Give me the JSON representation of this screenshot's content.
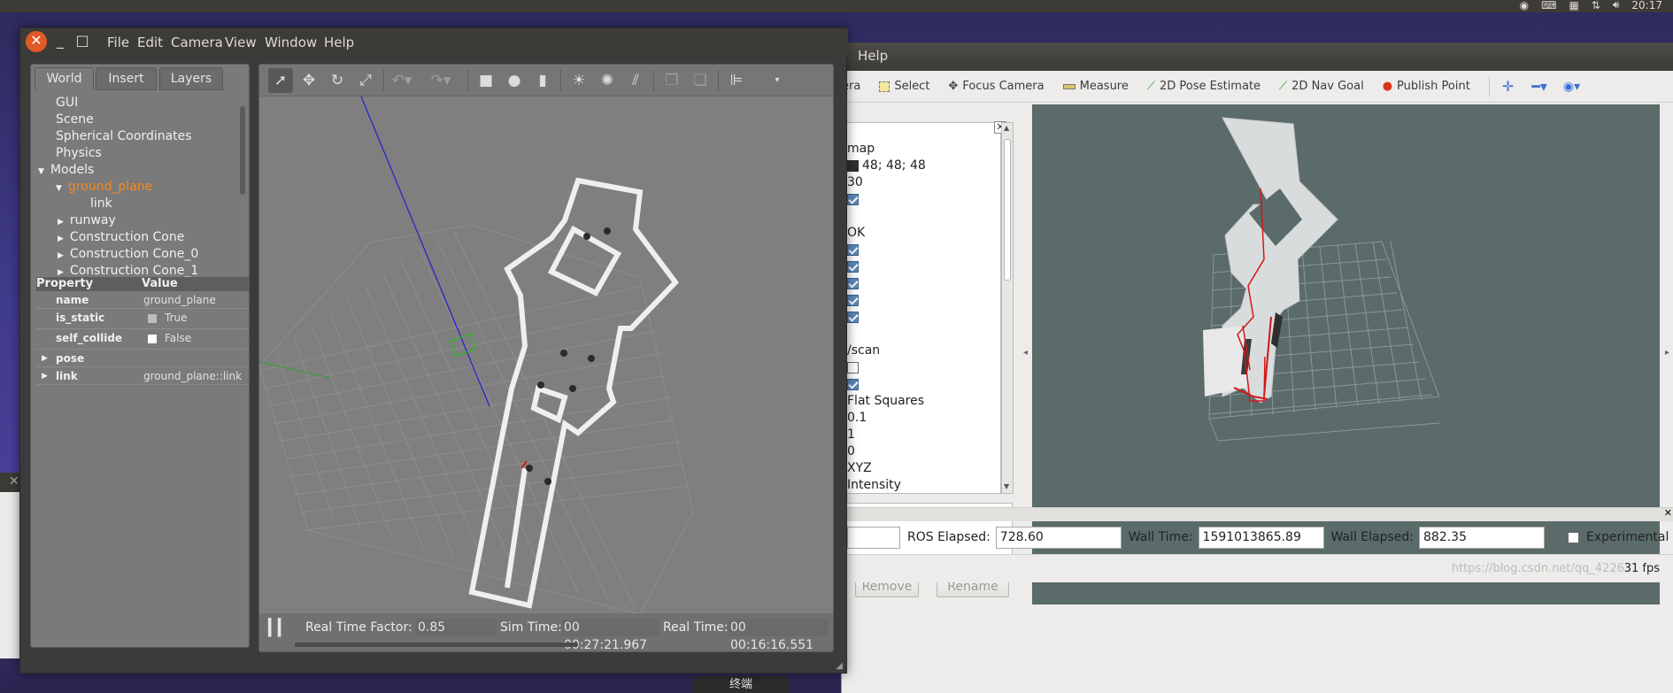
{
  "top_panel": {
    "clock": "20:17",
    "tray_icons": [
      "skype-icon",
      "keyboard-icon",
      "keyboard-icon",
      "network-icon",
      "volume-icon"
    ]
  },
  "rviz": {
    "menu_label": "Help",
    "tools": [
      {
        "label": "era",
        "icon": "camera-icon"
      },
      {
        "label": "Select",
        "icon": "select-icon"
      },
      {
        "label": "Focus Camera",
        "icon": "focus-icon"
      },
      {
        "label": "Measure",
        "icon": "ruler-icon"
      },
      {
        "label": "2D Pose Estimate",
        "icon": "green-arrow-icon"
      },
      {
        "label": "2D Nav Goal",
        "icon": "green-arrow-icon"
      },
      {
        "label": "Publish Point",
        "icon": "pin-icon"
      }
    ],
    "displays": {
      "map_label": "map",
      "background_color": "48; 48; 48",
      "frame_rate": "30",
      "status": "OK",
      "scan_label": "/scan",
      "style": "Flat Squares",
      "size": "0.1",
      "alpha": "1",
      "decay": "0",
      "position_transformer": "XYZ",
      "color_transformer": "Intensity"
    },
    "buttons": {
      "remove": "Remove",
      "rename": "Rename"
    },
    "time": {
      "ros_elapsed_label": "ROS Elapsed:",
      "ros_elapsed": "728.60",
      "wall_time_label": "Wall Time:",
      "wall_time": "1591013865.89",
      "wall_elapsed_label": "Wall Elapsed:",
      "wall_elapsed": "882.35",
      "experimental_label": "Experimental"
    },
    "fps": "31 fps",
    "watermark": "https://blog.csdn.net/qq_4226"
  },
  "gazebo": {
    "menus": [
      "File",
      "Edit",
      "Camera",
      "View",
      "Window",
      "Help"
    ],
    "tabs": [
      "World",
      "Insert",
      "Layers"
    ],
    "tree": {
      "gui": "GUI",
      "scene": "Scene",
      "spherical": "Spherical Coordinates",
      "physics": "Physics",
      "models": "Models",
      "ground_plane": "ground_plane",
      "link": "link",
      "runway": "runway",
      "cone": "Construction Cone",
      "cone0": "Construction Cone_0",
      "cone1": "Construction Cone_1"
    },
    "props": {
      "header_property": "Property",
      "header_value": "Value",
      "name_key": "name",
      "name_val": "ground_plane",
      "static_key": "is_static",
      "static_val": "True",
      "collide_key": "self_collide",
      "collide_val": "False",
      "pose_key": "pose",
      "link_key": "link",
      "link_val": "ground_plane::link"
    },
    "status": {
      "rtf_label": "Real Time Factor:",
      "rtf": "0.85",
      "sim_label": "Sim Time:",
      "sim": "00 00:27:21.967",
      "real_label": "Real Time:",
      "real": "00 00:16:16.551"
    }
  },
  "taskbar": {
    "terminal": "终端"
  }
}
